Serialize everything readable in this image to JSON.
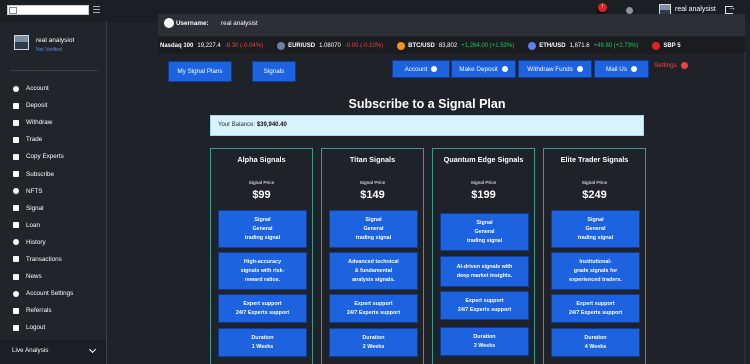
{
  "topbar": {
    "username": "real analysist"
  },
  "sidebar": {
    "username": "real analysiot",
    "status": "Not Verified",
    "items": [
      {
        "label": "Account",
        "icon": "account-icon"
      },
      {
        "label": "Deposit",
        "icon": "dollar-icon"
      },
      {
        "label": "Withdraw",
        "icon": "withdraw-icon"
      },
      {
        "label": "Trade",
        "icon": "chevron-right-icon"
      },
      {
        "label": "Copy Experts",
        "icon": "copy-icon"
      },
      {
        "label": "Subscribe",
        "icon": "subscribe-icon"
      },
      {
        "label": "NFTS",
        "icon": "diamond-icon"
      },
      {
        "label": "Signal",
        "icon": "signal-icon"
      },
      {
        "label": "Loan",
        "icon": "loan-icon"
      },
      {
        "label": "History",
        "icon": "history-icon"
      },
      {
        "label": "Transactions",
        "icon": "transactions-icon"
      },
      {
        "label": "News",
        "icon": "news-icon"
      },
      {
        "label": "Account Settings",
        "icon": "settings-icon"
      },
      {
        "label": "Referrals",
        "icon": "referrals-icon"
      },
      {
        "label": "Logout",
        "icon": "logout-icon"
      }
    ],
    "live_analysis": "Live Analysis"
  },
  "greeting": {
    "label": "Username:",
    "value": "real analysist"
  },
  "ticker": [
    {
      "name": "Nasdaq 100",
      "price": "19,227.4",
      "change": "-8.30 (-0.04%)",
      "dir": "neg",
      "dot": ""
    },
    {
      "name": "EUR/USD",
      "price": "1.08070",
      "change": "-0.00 (-0.10%)",
      "dir": "neg",
      "dot": "#6b7fa8"
    },
    {
      "name": "BTC/USD",
      "price": "83,802",
      "change": "+1,264.00 (+1.53%)",
      "dir": "pos",
      "dot": "#f7931a"
    },
    {
      "name": "ETH/USD",
      "price": "1,871.6",
      "change": "+49.80 (+2.73%)",
      "dir": "pos",
      "dot": "#627eea"
    },
    {
      "name": "SBP 5",
      "price": "",
      "change": "",
      "dir": "pos",
      "dot": "#e02424"
    }
  ],
  "actions": {
    "my_signal_plans": "My Signal Plans",
    "signals": "Signals",
    "account": "Account",
    "make_deposit": "Make Deposit",
    "withdraw_funds": "Withdraw Funds",
    "mail_us": "Mail Us",
    "settings": "Settings"
  },
  "page_title": "Subscribe to a Signal Plan",
  "balance": {
    "label": "Your Balance:",
    "value": "$39,940.40"
  },
  "plans": [
    {
      "name": "Alpha Signals",
      "price_label": "Signal Price",
      "price": "$99",
      "features": [
        "Signal\nGeneral\ntrading signal",
        "High-accuracy\nsignals with risk-\nreward ratios.",
        "Expert support\n24/7 Experts support",
        "Duration\n1 Weeks"
      ]
    },
    {
      "name": "Titan Signals",
      "price_label": "Signal Price",
      "price": "$149",
      "features": [
        "Signal\nGeneral\ntrading signal",
        "Advanced technical\n& fundamental\nanalysis signals.",
        "Expert support\n24/7 Experts support",
        "Duration\n2 Weeks"
      ]
    },
    {
      "name": "Quantum Edge Signals",
      "price_label": "Signal Price",
      "price": "$199",
      "features": [
        "Signal\nGeneral\ntrading signal",
        "AI-driven signals with\ndeep market insights.",
        "Expert support\n24/7 Experts support",
        "Duration\n3 Weeks"
      ]
    },
    {
      "name": "Elite Trader Signals",
      "price_label": "Signal Price",
      "price": "$249",
      "features": [
        "Signal\nGeneral\ntrading signal",
        "Institutional-\ngrade signals for\nexperienced traders.",
        "Expert support\n24/7 Experts support",
        "Duration\n4 Weeks"
      ]
    }
  ],
  "colors": {
    "primary": "#1d63e0",
    "accent_red": "#ef4444",
    "card_border": "#3a9b8f",
    "balance_bg": "#d8f3fb"
  }
}
